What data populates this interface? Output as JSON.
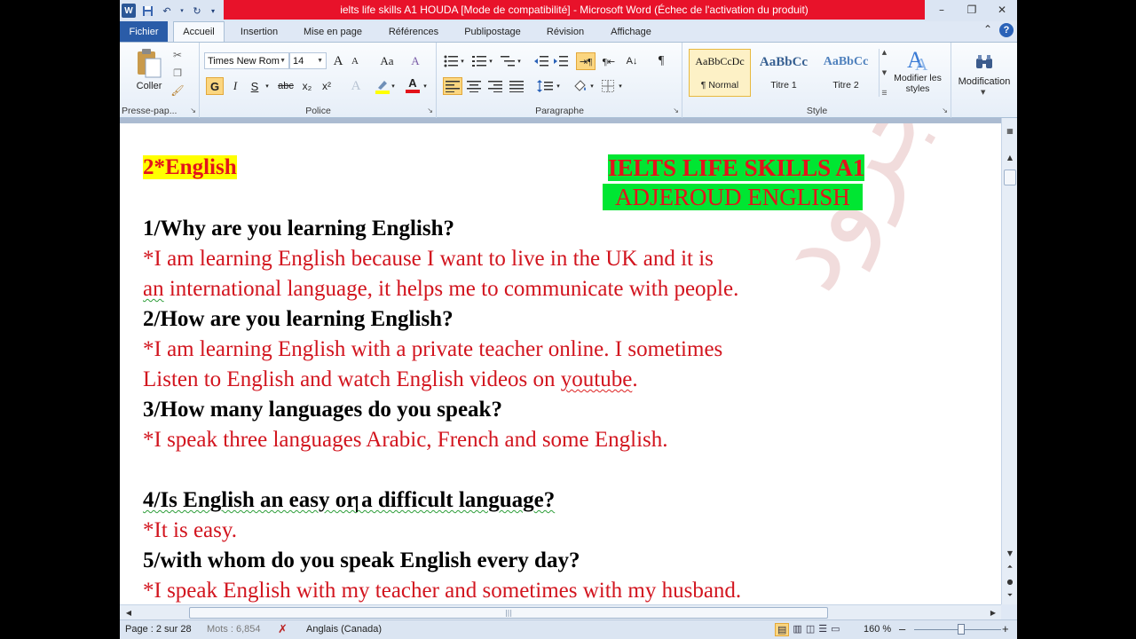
{
  "window": {
    "title": "ielts life skills A1 HOUDA [Mode de compatibilité]  -  Microsoft Word (Échec de l'activation du produit)",
    "app_icon": "W",
    "controls": [
      "–",
      "❐",
      "✕"
    ]
  },
  "tabs": [
    "Fichier",
    "Accueil",
    "Insertion",
    "Mise en page",
    "Références",
    "Publipostage",
    "Révision",
    "Affichage"
  ],
  "ribbon": {
    "clipboard": {
      "paste_label": "Coller",
      "group_label": "Presse-pap..."
    },
    "font": {
      "group_label": "Police",
      "font_name": "Times New Rom",
      "font_size": "14",
      "bold": "G",
      "italic": "I",
      "underline": "S",
      "strike": "abc",
      "sub": "x₂",
      "sup": "x²",
      "grow": "A",
      "shrink": "A",
      "case": "Aa",
      "clear": "A",
      "color_a": "A"
    },
    "paragraph": {
      "group_label": "Paragraphe",
      "pilcrow": "¶"
    },
    "styles": {
      "group_label": "Style",
      "items": [
        {
          "preview": "AaBbCcDc",
          "name": "¶ Normal"
        },
        {
          "preview": "AaBbCc",
          "name": "Titre 1"
        },
        {
          "preview": "AaBbCc",
          "name": "Titre 2"
        }
      ],
      "change_styles": "Modifier les styles"
    },
    "editing": {
      "label": "Modification"
    }
  },
  "document": {
    "heading": "2*English",
    "banner_line1": "IELTS LIFE SKILLS A1",
    "banner_line2": "ADJEROUD ENGLISH",
    "q1": "1/Why are you learning  English?",
    "a1_line1": "*I am learning  English  because I want to live  in the UK and it is",
    "a1_line2_pre": " ",
    "a1_line2_word": "an",
    "a1_line2_rest": " international  language,  it helps me to communicate with people.",
    "q2": "2/How are you learning  English?",
    "a2_line1": "*I am learning  English  with a private teacher online. I sometimes",
    "a2_line2_main": " Listen  to English  and watch English  videos  on ",
    "a2_line2_word": "youtube",
    "a2_line2_end": ".",
    "q3": "3/How many languages  do you speak?",
    "a3": "*I speak three languages  Arabic, French and some English.",
    "q4_main": "4/Is English an easy or a difficult language?",
    "a4": " *It is  easy.",
    "q5": "5/with whom do you speak English every day?",
    "a5": "*I speak English  with my teacher and sometimes  with my husband.",
    "watermark": "الأستاذة عجرود"
  },
  "statusbar": {
    "page": "Page : 2 sur 28",
    "words": "Mots : 6,854",
    "language": "Anglais (Canada)",
    "zoom": "160 %",
    "minus": "–",
    "plus": "+"
  }
}
